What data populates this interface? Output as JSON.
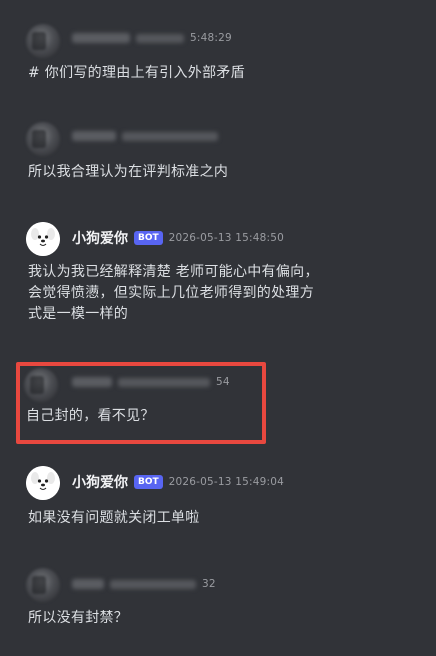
{
  "messages": [
    {
      "id": "m1",
      "author": "",
      "timestamp_suffix": "5:48:29",
      "text": "# 你们写的理由上有引入外部矛盾"
    },
    {
      "id": "m2",
      "author": "",
      "timestamp_suffix": "",
      "text": "所以我合理认为在评判标准之内"
    },
    {
      "id": "m3",
      "author": "小狗爱你",
      "badge": "BOT",
      "timestamp": "2026-05-13 15:48:50",
      "text_lines": [
        "我认为我已经解释清楚 老师可能心中有偏向，",
        "会觉得愤懑，但实际上几位老师得到的处理方",
        "式是一模一样的"
      ]
    },
    {
      "id": "m4",
      "author": "",
      "timestamp_suffix": "54",
      "text": "自己封的，看不见？"
    },
    {
      "id": "m5",
      "author": "小狗爱你",
      "badge": "BOT",
      "timestamp": "2026-05-13 15:49:04",
      "text": "如果没有问题就关闭工单啦"
    },
    {
      "id": "m6",
      "author": "",
      "timestamp_suffix": "32",
      "text": "所以没有封禁？"
    }
  ],
  "colors": {
    "background": "#313338",
    "bot_badge": "#5865f2",
    "highlight_box": "#e8483f"
  }
}
